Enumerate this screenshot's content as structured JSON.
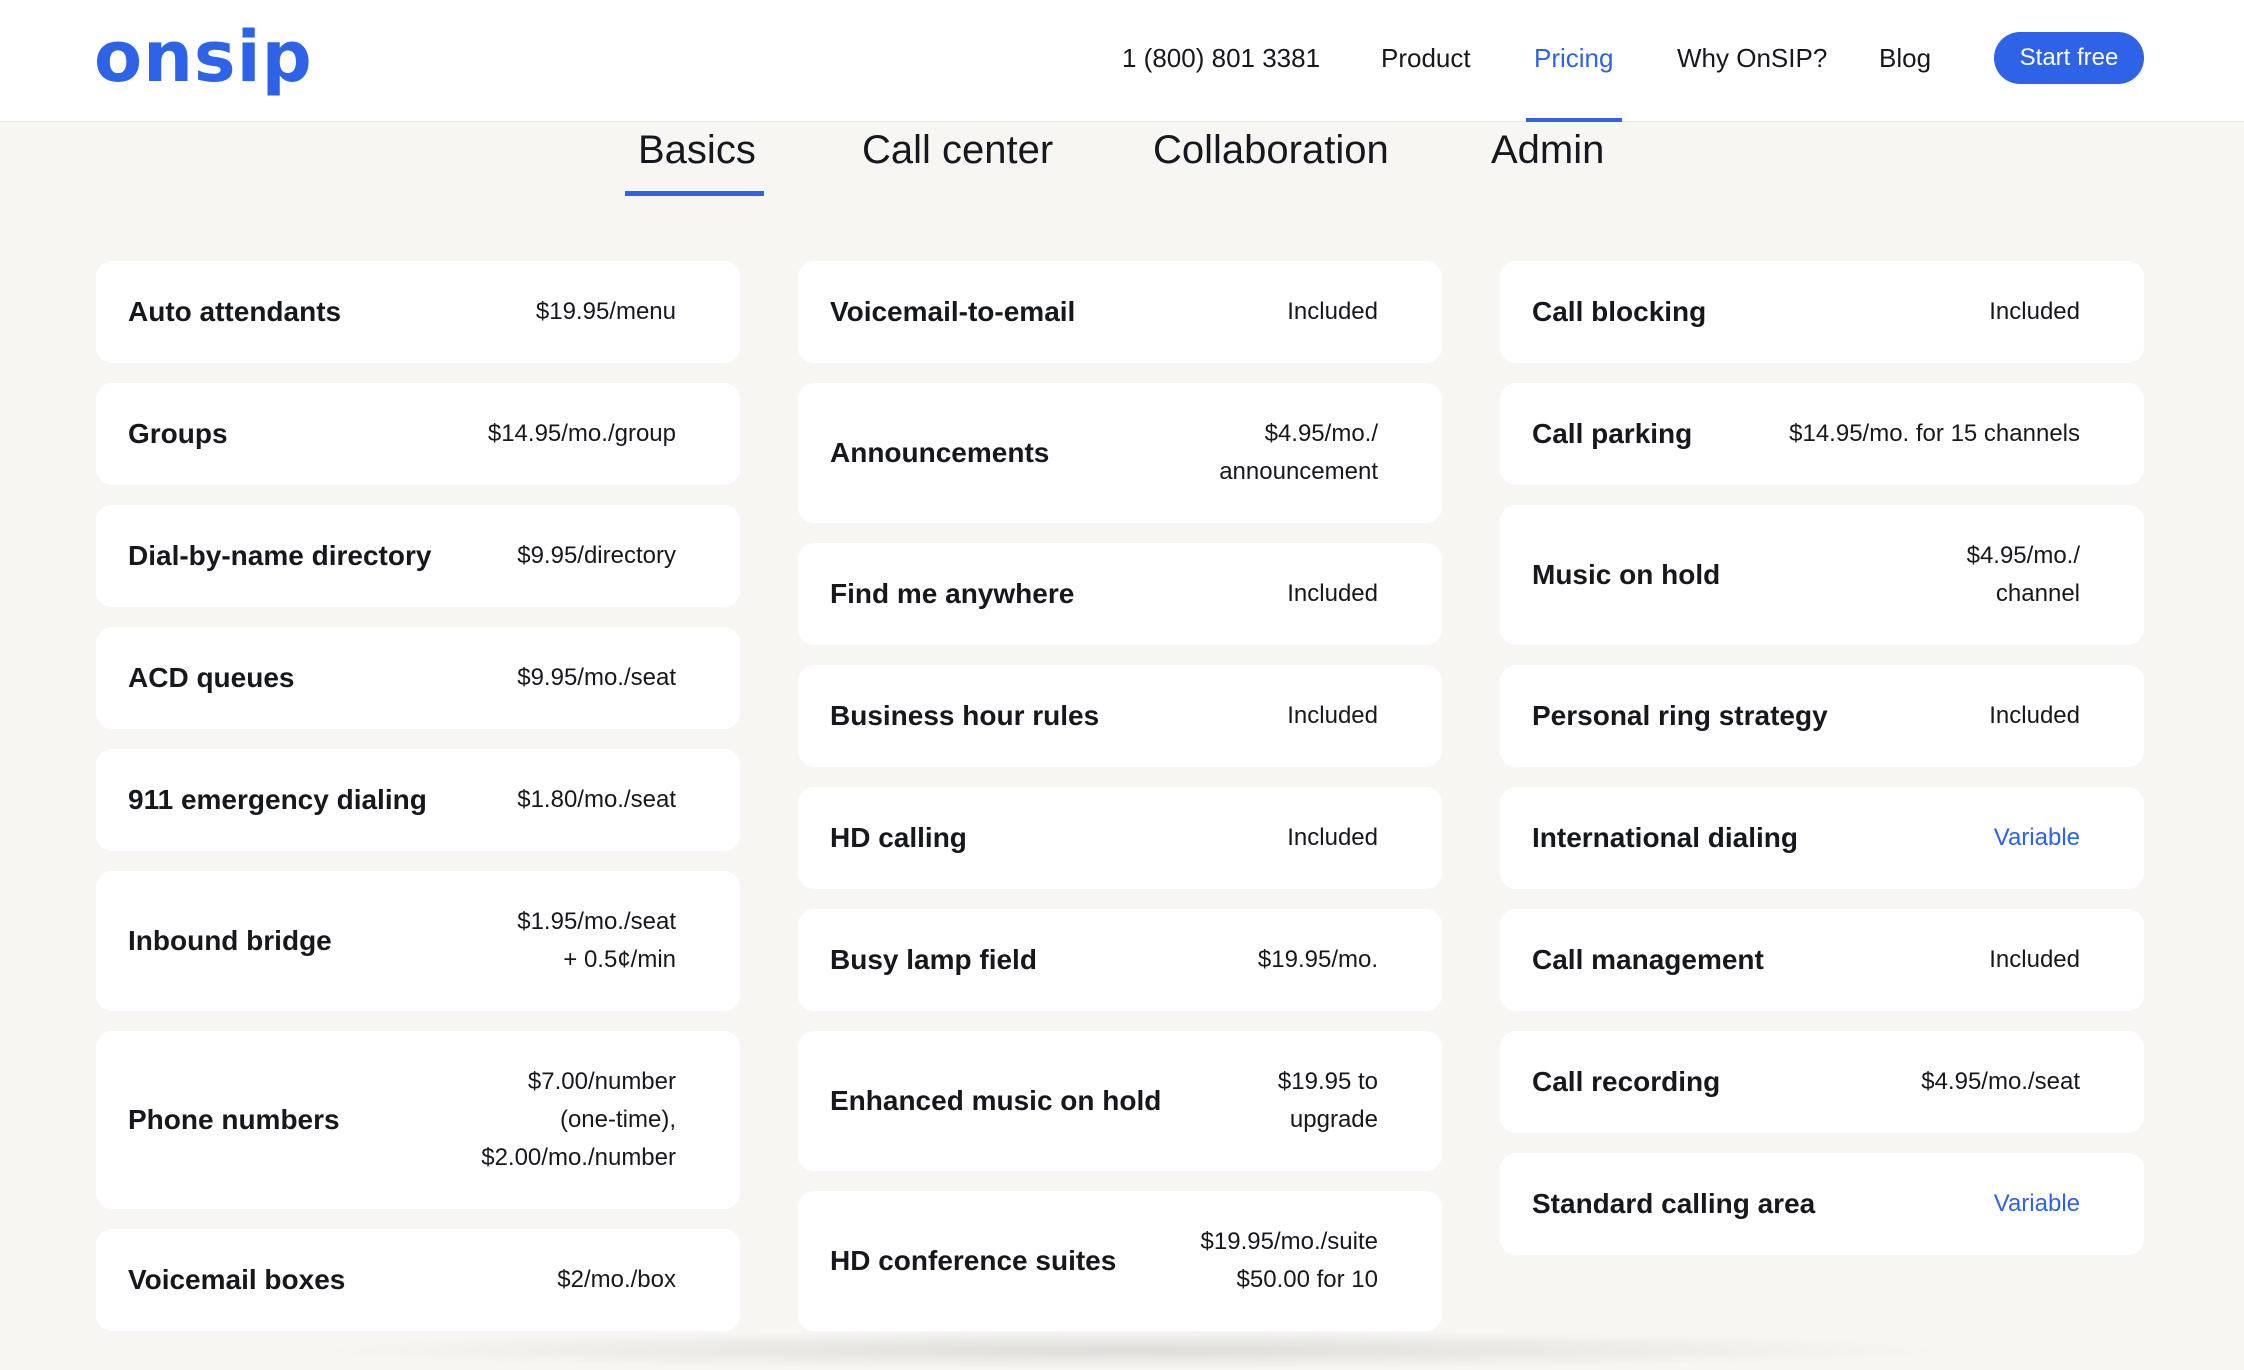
{
  "brand": {
    "logo_text": "onsip",
    "accent_color": "#2e63e8"
  },
  "nav": {
    "phone": "1 (800) 801 3381",
    "items": [
      "Product",
      "Pricing",
      "Why OnSIP?",
      "Blog"
    ],
    "active": "Pricing",
    "cta_label": "Start free"
  },
  "tabs": {
    "items": [
      "Basics",
      "Call center",
      "Collaboration",
      "Admin"
    ],
    "active": "Basics"
  },
  "columns": [
    [
      {
        "label": "Auto attendants",
        "price": "$19.95/menu"
      },
      {
        "label": "Groups",
        "price": "$14.95/mo./group"
      },
      {
        "label": "Dial-by-name directory",
        "price": "$9.95/directory"
      },
      {
        "label": "ACD queues",
        "price": "$9.95/mo./seat"
      },
      {
        "label": "911 emergency dialing",
        "price": "$1.80/mo./seat"
      },
      {
        "label": "Inbound bridge",
        "price": "$1.95/mo./seat\n+ 0.5¢/min"
      },
      {
        "label": "Phone numbers",
        "price": "$7.00/number\n(one-time),\n$2.00/mo./number"
      },
      {
        "label": "Voicemail boxes",
        "price": "$2/mo./box"
      }
    ],
    [
      {
        "label": "Voicemail-to-email",
        "price": "Included"
      },
      {
        "label": "Announcements",
        "price": "$4.95/mo./\nannouncement"
      },
      {
        "label": "Find me anywhere",
        "price": "Included"
      },
      {
        "label": "Business hour rules",
        "price": "Included"
      },
      {
        "label": "HD calling",
        "price": "Included"
      },
      {
        "label": "Busy lamp field",
        "price": "$19.95/mo."
      },
      {
        "label": "Enhanced music on hold",
        "price": "$19.95 to\nupgrade"
      },
      {
        "label": "HD conference suites",
        "price": "$19.95/mo./suite\n$50.00 for 10"
      }
    ],
    [
      {
        "label": "Call blocking",
        "price": "Included"
      },
      {
        "label": "Call parking",
        "price": "$14.95/mo. for 15 channels"
      },
      {
        "label": "Music on hold",
        "price": "$4.95/mo./\nchannel"
      },
      {
        "label": "Personal ring strategy",
        "price": "Included"
      },
      {
        "label": "International dialing",
        "price": "Variable",
        "link": true
      },
      {
        "label": "Call management",
        "price": "Included"
      },
      {
        "label": "Call recording",
        "price": "$4.95/mo./seat"
      },
      {
        "label": "Standard calling area",
        "price": "Variable",
        "link": true
      }
    ]
  ]
}
